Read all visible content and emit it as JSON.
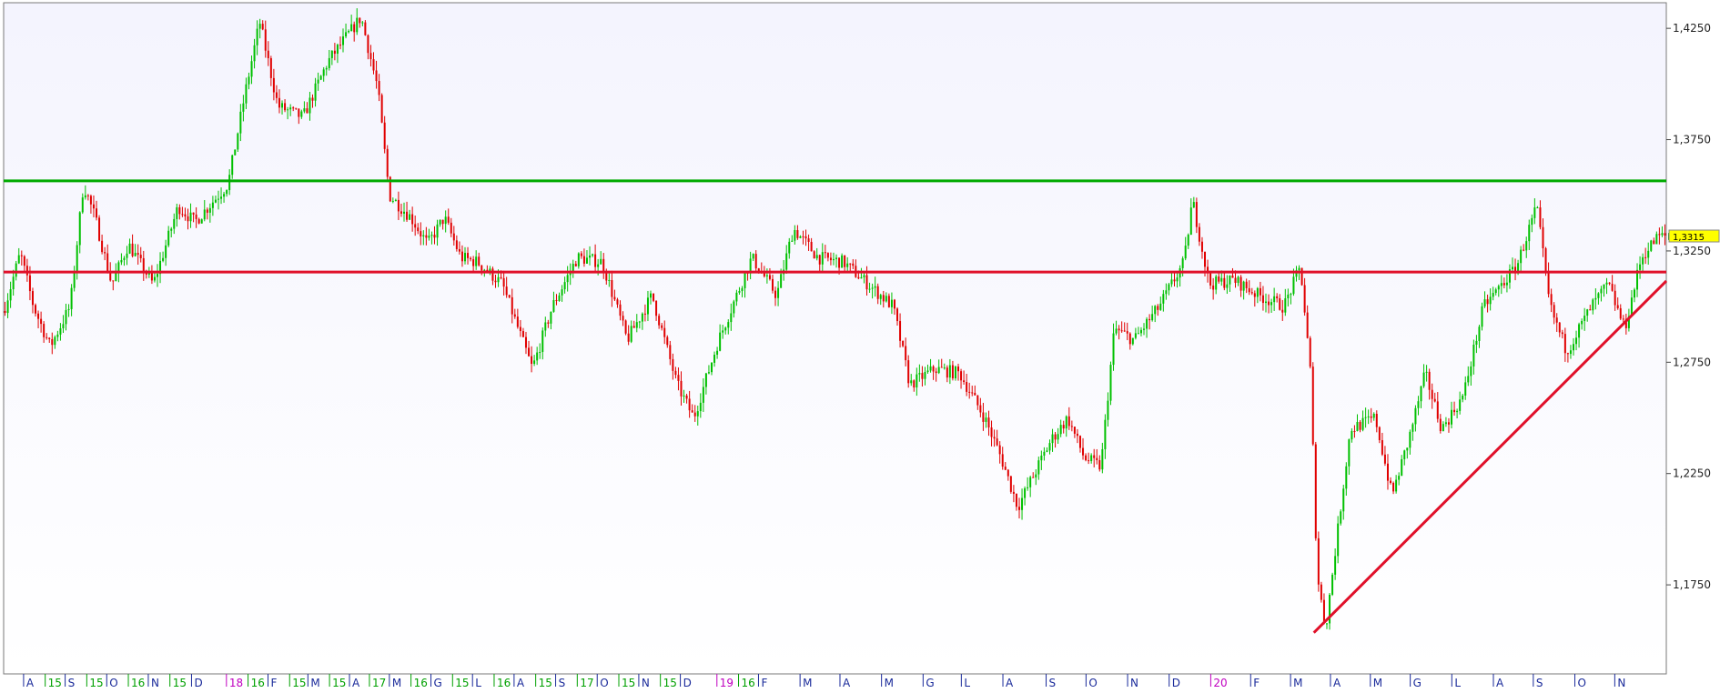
{
  "chart_data": {
    "type": "candlestick",
    "y_axis": {
      "ylim": [
        1.135,
        1.4365
      ],
      "ticks": [
        "1,4250",
        "1,3750",
        "1,3250",
        "1,2750",
        "1,2250",
        "1,1750"
      ],
      "tick_values": [
        1.425,
        1.375,
        1.325,
        1.275,
        1.225,
        1.175
      ],
      "position": "right"
    },
    "last_price": {
      "label": "1,3315",
      "value": 1.3315
    },
    "x_axis": {
      "labels": [
        {
          "text": "A",
          "t": 0.012,
          "kind": "month"
        },
        {
          "text": "15",
          "t": 0.025,
          "kind": "year-mid"
        },
        {
          "text": "S",
          "t": 0.037,
          "kind": "month"
        },
        {
          "text": "15",
          "t": 0.05,
          "kind": "year-mid"
        },
        {
          "text": "O",
          "t": 0.062,
          "kind": "month"
        },
        {
          "text": "16",
          "t": 0.075,
          "kind": "year-mid"
        },
        {
          "text": "N",
          "t": 0.087,
          "kind": "month"
        },
        {
          "text": "15",
          "t": 0.1,
          "kind": "year-mid"
        },
        {
          "text": "D",
          "t": 0.113,
          "kind": "month"
        },
        {
          "text": "18",
          "t": 0.134,
          "kind": "year"
        },
        {
          "text": "16",
          "t": 0.147,
          "kind": "year-mid"
        },
        {
          "text": "F",
          "t": 0.159,
          "kind": "month"
        },
        {
          "text": "15",
          "t": 0.172,
          "kind": "year-mid"
        },
        {
          "text": "M",
          "t": 0.183,
          "kind": "month"
        },
        {
          "text": "15",
          "t": 0.196,
          "kind": "year-mid"
        },
        {
          "text": "A",
          "t": 0.208,
          "kind": "month"
        },
        {
          "text": "17",
          "t": 0.22,
          "kind": "year-mid"
        },
        {
          "text": "M",
          "t": 0.232,
          "kind": "month"
        },
        {
          "text": "16",
          "t": 0.245,
          "kind": "year-mid"
        },
        {
          "text": "G",
          "t": 0.257,
          "kind": "month"
        },
        {
          "text": "15",
          "t": 0.27,
          "kind": "year-mid"
        },
        {
          "text": "L",
          "t": 0.282,
          "kind": "month"
        },
        {
          "text": "16",
          "t": 0.295,
          "kind": "year-mid"
        },
        {
          "text": "A",
          "t": 0.307,
          "kind": "month"
        },
        {
          "text": "15",
          "t": 0.32,
          "kind": "year-mid"
        },
        {
          "text": "S",
          "t": 0.332,
          "kind": "month"
        },
        {
          "text": "17",
          "t": 0.345,
          "kind": "year-mid"
        },
        {
          "text": "O",
          "t": 0.357,
          "kind": "month"
        },
        {
          "text": "15",
          "t": 0.37,
          "kind": "year-mid"
        },
        {
          "text": "N",
          "t": 0.382,
          "kind": "month"
        },
        {
          "text": "15",
          "t": 0.395,
          "kind": "year-mid"
        },
        {
          "text": "D",
          "t": 0.407,
          "kind": "month"
        },
        {
          "text": "19",
          "t": 0.429,
          "kind": "year"
        },
        {
          "text": "16",
          "t": 0.442,
          "kind": "year-mid"
        },
        {
          "text": "F",
          "t": 0.454,
          "kind": "month"
        },
        {
          "text": "M",
          "t": 0.479,
          "kind": "month"
        },
        {
          "text": "A",
          "t": 0.503,
          "kind": "month"
        },
        {
          "text": "M",
          "t": 0.528,
          "kind": "month"
        },
        {
          "text": "G",
          "t": 0.553,
          "kind": "month"
        },
        {
          "text": "L",
          "t": 0.576,
          "kind": "month"
        },
        {
          "text": "A",
          "t": 0.601,
          "kind": "month"
        },
        {
          "text": "S",
          "t": 0.627,
          "kind": "month"
        },
        {
          "text": "O",
          "t": 0.651,
          "kind": "month"
        },
        {
          "text": "N",
          "t": 0.676,
          "kind": "month"
        },
        {
          "text": "D",
          "t": 0.701,
          "kind": "month"
        },
        {
          "text": "20",
          "t": 0.726,
          "kind": "year"
        },
        {
          "text": "F",
          "t": 0.75,
          "kind": "month"
        },
        {
          "text": "M",
          "t": 0.774,
          "kind": "month"
        },
        {
          "text": "A",
          "t": 0.798,
          "kind": "month"
        },
        {
          "text": "M",
          "t": 0.822,
          "kind": "month"
        },
        {
          "text": "G",
          "t": 0.846,
          "kind": "month"
        },
        {
          "text": "L",
          "t": 0.871,
          "kind": "month"
        },
        {
          "text": "A",
          "t": 0.896,
          "kind": "month"
        },
        {
          "text": "S",
          "t": 0.92,
          "kind": "month"
        },
        {
          "text": "O",
          "t": 0.945,
          "kind": "month"
        },
        {
          "text": "N",
          "t": 0.969,
          "kind": "month"
        }
      ]
    },
    "price_path": [
      [
        0.0,
        1.298
      ],
      [
        0.01,
        1.324
      ],
      [
        0.018,
        1.3
      ],
      [
        0.028,
        1.282
      ],
      [
        0.04,
        1.3
      ],
      [
        0.048,
        1.355
      ],
      [
        0.055,
        1.34
      ],
      [
        0.065,
        1.31
      ],
      [
        0.075,
        1.328
      ],
      [
        0.09,
        1.31
      ],
      [
        0.105,
        1.345
      ],
      [
        0.115,
        1.338
      ],
      [
        0.135,
        1.355
      ],
      [
        0.145,
        1.395
      ],
      [
        0.154,
        1.428
      ],
      [
        0.165,
        1.39
      ],
      [
        0.18,
        1.385
      ],
      [
        0.195,
        1.41
      ],
      [
        0.215,
        1.43
      ],
      [
        0.225,
        1.398
      ],
      [
        0.232,
        1.35
      ],
      [
        0.245,
        1.34
      ],
      [
        0.255,
        1.328
      ],
      [
        0.265,
        1.34
      ],
      [
        0.275,
        1.322
      ],
      [
        0.285,
        1.32
      ],
      [
        0.3,
        1.31
      ],
      [
        0.318,
        1.272
      ],
      [
        0.33,
        1.3
      ],
      [
        0.345,
        1.322
      ],
      [
        0.36,
        1.32
      ],
      [
        0.375,
        1.285
      ],
      [
        0.39,
        1.305
      ],
      [
        0.405,
        1.265
      ],
      [
        0.415,
        1.25
      ],
      [
        0.43,
        1.285
      ],
      [
        0.45,
        1.322
      ],
      [
        0.465,
        1.305
      ],
      [
        0.475,
        1.335
      ],
      [
        0.49,
        1.322
      ],
      [
        0.505,
        1.32
      ],
      [
        0.52,
        1.31
      ],
      [
        0.535,
        1.3
      ],
      [
        0.545,
        1.265
      ],
      [
        0.56,
        1.272
      ],
      [
        0.575,
        1.27
      ],
      [
        0.59,
        1.25
      ],
      [
        0.6,
        1.232
      ],
      [
        0.61,
        1.21
      ],
      [
        0.62,
        1.225
      ],
      [
        0.63,
        1.24
      ],
      [
        0.64,
        1.25
      ],
      [
        0.65,
        1.232
      ],
      [
        0.66,
        1.228
      ],
      [
        0.668,
        1.29
      ],
      [
        0.68,
        1.285
      ],
      [
        0.695,
        1.3
      ],
      [
        0.71,
        1.32
      ],
      [
        0.715,
        1.348
      ],
      [
        0.725,
        1.31
      ],
      [
        0.74,
        1.312
      ],
      [
        0.755,
        1.305
      ],
      [
        0.77,
        1.3
      ],
      [
        0.78,
        1.318
      ],
      [
        0.786,
        1.27
      ],
      [
        0.79,
        1.18
      ],
      [
        0.795,
        1.155
      ],
      [
        0.8,
        1.185
      ],
      [
        0.81,
        1.245
      ],
      [
        0.825,
        1.25
      ],
      [
        0.835,
        1.215
      ],
      [
        0.845,
        1.24
      ],
      [
        0.855,
        1.27
      ],
      [
        0.865,
        1.245
      ],
      [
        0.878,
        1.26
      ],
      [
        0.89,
        1.3
      ],
      [
        0.91,
        1.318
      ],
      [
        0.922,
        1.345
      ],
      [
        0.93,
        1.3
      ],
      [
        0.94,
        1.28
      ],
      [
        0.955,
        1.3
      ],
      [
        0.965,
        1.31
      ],
      [
        0.975,
        1.29
      ],
      [
        0.985,
        1.322
      ],
      [
        0.995,
        1.3315
      ]
    ],
    "horizontal_lines": [
      {
        "value": 1.3565,
        "color": "#00aa00"
      },
      {
        "value": 1.3155,
        "color": "#e0102a"
      }
    ],
    "trend_line": {
      "from": [
        0.788,
        1.1535
      ],
      "to": [
        1.0,
        1.3115
      ],
      "color": "#e0102a"
    },
    "colors": {
      "up": "#00c000",
      "down": "#e00000",
      "background_top": "#f4f4fe",
      "background_bottom": "#ffffff",
      "last_price_bg": "#ffff00",
      "x_month": "#1a2a9a",
      "x_mid": "#00a000",
      "x_year": "#c000c0"
    }
  }
}
